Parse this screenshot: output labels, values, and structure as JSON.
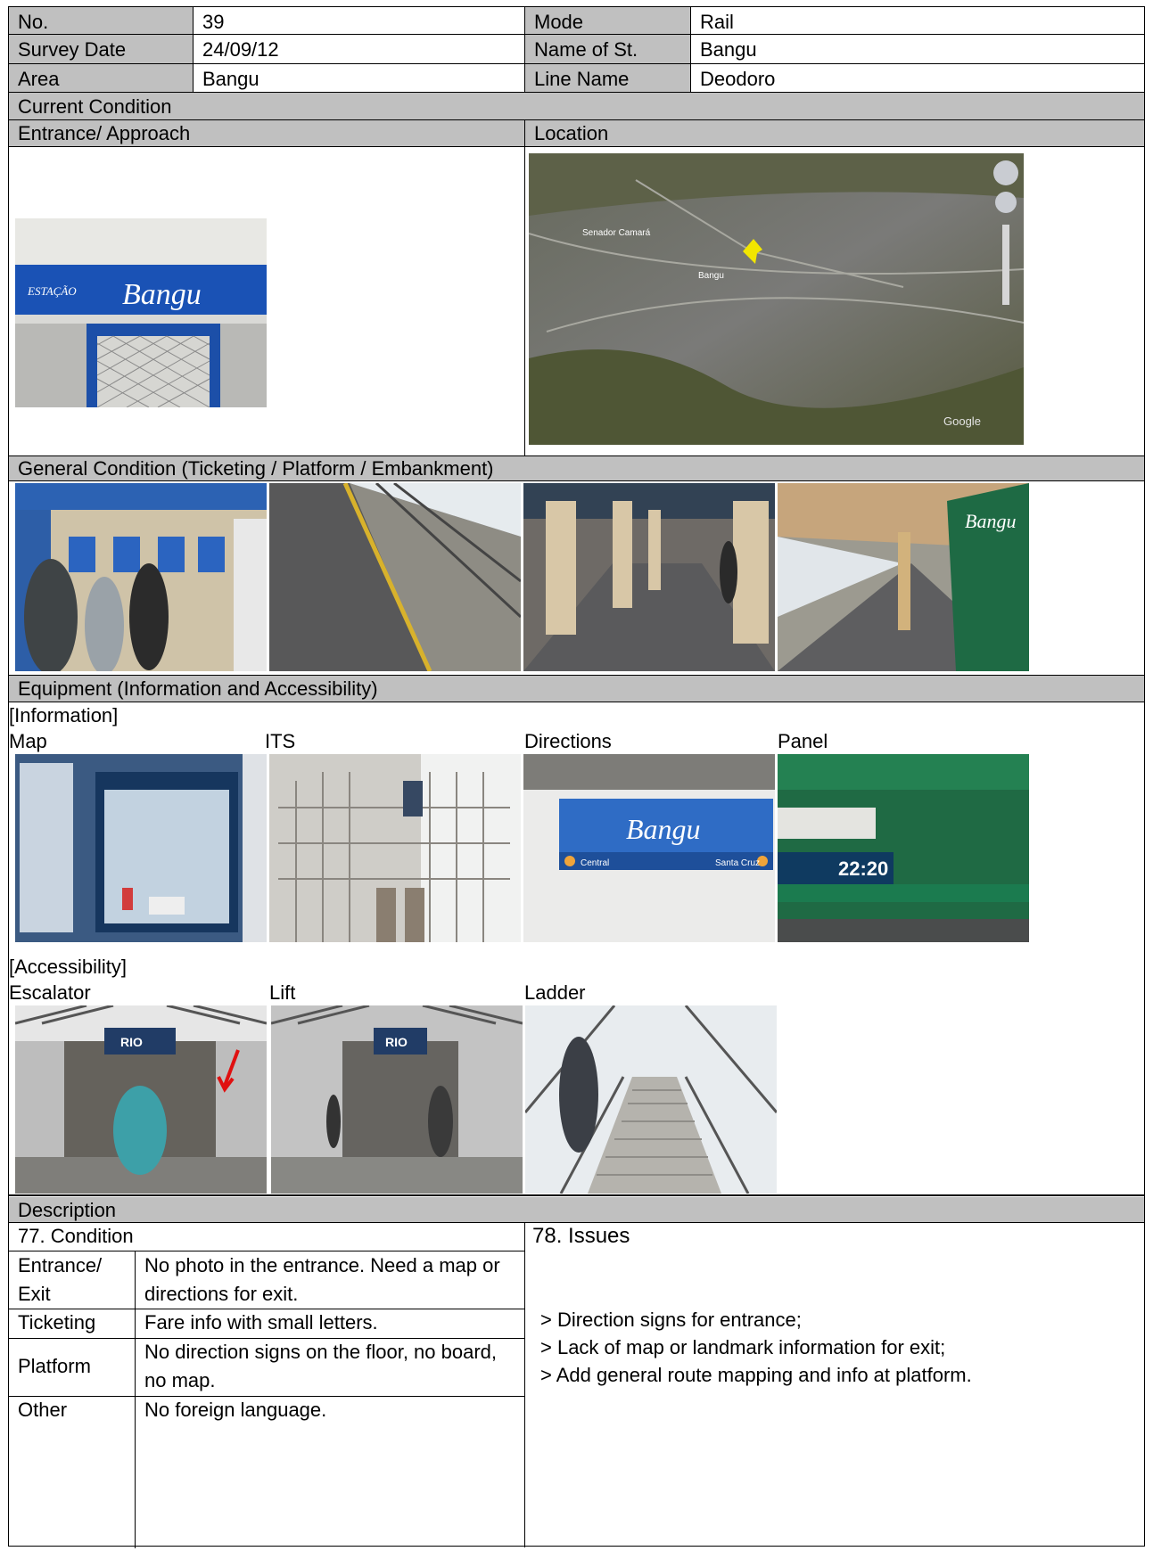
{
  "header": {
    "rows": [
      {
        "label1": "No.",
        "value1": "39",
        "label2": "Mode",
        "value2": "Rail"
      },
      {
        "label1": "Survey Date",
        "value1": "24/09/12",
        "label2": "Name of St.",
        "value2": "Bangu"
      },
      {
        "label1": "Area",
        "value1": "Bangu",
        "label2": "Line Name",
        "value2": "Deodoro"
      }
    ]
  },
  "sections": {
    "current_condition": "Current Condition",
    "entrance": "Entrance/ Approach",
    "location": "Location",
    "general": "General Condition (Ticketing / Platform / Embankment)",
    "equipment": "Equipment (Information  and Accessibility)",
    "information": "[Information]",
    "accessibility": "[Accessibility]",
    "description": "Description",
    "condition": "77. Condition",
    "issues": "78. Issues"
  },
  "entrance_photo": {
    "sign_small": "ESTAÇÃO",
    "sign_name": "Bangu"
  },
  "map": {
    "places": [
      "Senador Camará",
      "Bangu"
    ],
    "watermark": "Google",
    "pin_color": "#f2e600"
  },
  "info_labels": [
    "Map",
    "ITS",
    "Directions",
    "Panel"
  ],
  "info_photos": {
    "directions_sign": "Bangu",
    "directions_left": "Central",
    "directions_right": "Santa Cruz",
    "panel_time": "22:20"
  },
  "access_labels": [
    "Escalator",
    "Lift",
    "Ladder"
  ],
  "access_photos": {
    "elevator_sign": "RIO"
  },
  "conditions": [
    {
      "item": "Entrance/ Exit",
      "text": "No photo in the entrance. Need a map or directions for exit."
    },
    {
      "item": "Ticketing",
      "text": "Fare info with small letters."
    },
    {
      "item": "Platform",
      "text": "No direction signs on the floor, no board, no map."
    },
    {
      "item": "Other",
      "text": "No foreign language."
    }
  ],
  "issues": [
    "> Direction signs for entrance;",
    "> Lack of map or landmark information for exit;",
    "> Add general route mapping and info at platform."
  ]
}
